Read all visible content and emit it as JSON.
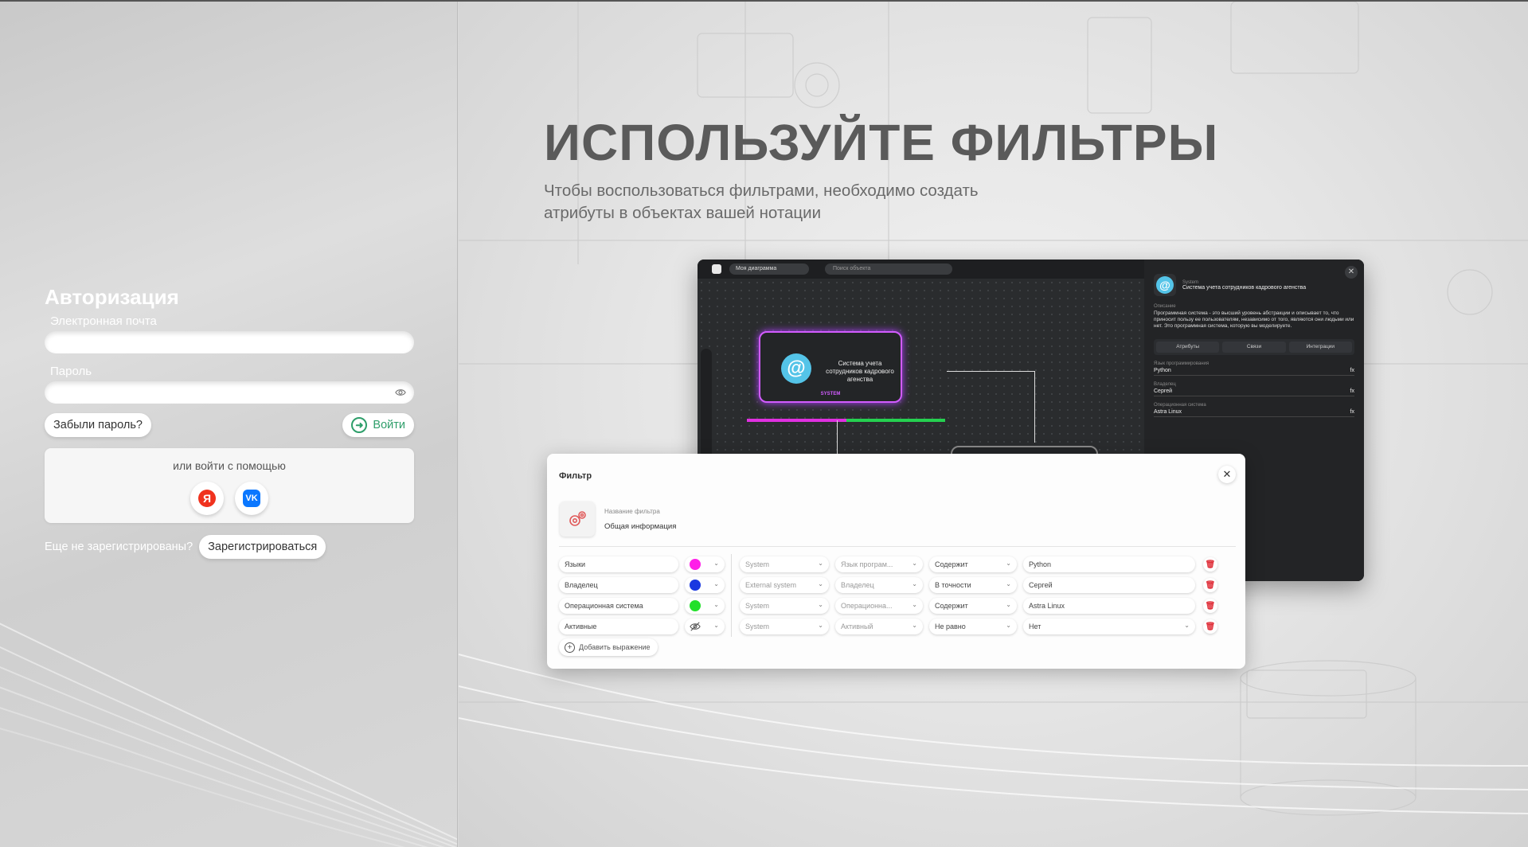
{
  "auth": {
    "title": "Авторизация",
    "email_label": "Электронная почта",
    "email_value": "",
    "password_label": "Пароль",
    "password_value": "",
    "forgot_label": "Забыли пароль?",
    "login_label": "Войти",
    "social_label": "или войти с помощью",
    "yandex_glyph": "Я",
    "vk_glyph": "VK",
    "not_registered": "Еще не зарегистрированы?",
    "register_label": "Зарегистрироваться"
  },
  "promo": {
    "title": "ИСПОЛЬЗУЙТЕ ФИЛЬТРЫ",
    "subtitle": "Чтобы воспользоваться фильтрами, необходимо создать атрибуты в объектах вашей нотации"
  },
  "app_mock": {
    "diagram_name": "Моя диаграмма",
    "search_placeholder": "Поиск объекта",
    "node_title": "Система учета сотрудников кадрового агенства",
    "node_type": "SYSTEM",
    "side": {
      "type": "System",
      "title": "Система учета сотрудников кадрового агенства",
      "desc_label": "Описание",
      "desc": "Программная система - это высший уровень абстракции и описывает то, что приносит пользу ее пользователям, независимо от того, являются они людьми или нет. Это программная система, которую вы моделируете.",
      "tabs": [
        "Атрибуты",
        "Связи",
        "Интеграции"
      ],
      "fields": [
        {
          "label": "Язык программирования",
          "value": "Python"
        },
        {
          "label": "Владелец",
          "value": "Сергей"
        },
        {
          "label": "Операционная система",
          "value": "Astra Linux"
        }
      ],
      "fx": "fx"
    }
  },
  "filter": {
    "title": "Фильтр",
    "name_label": "Название фильтра",
    "name_value": "Общая информация",
    "rows": [
      {
        "name": "Языки",
        "color": "#ff1ee8",
        "type": "System",
        "attr": "Язык програм...",
        "op": "Содержит",
        "value": "Python"
      },
      {
        "name": "Владелец",
        "color": "#1a38e0",
        "type": "External system",
        "attr": "Владелец",
        "op": "В точности",
        "value": "Сергей"
      },
      {
        "name": "Операционная система",
        "color": "#22e02a",
        "type": "System",
        "attr": "Операционна...",
        "op": "Содержит",
        "value": "Astra Linux"
      },
      {
        "name": "Активные",
        "color": "hidden",
        "type": "System",
        "attr": "Активный",
        "op": "Не равно",
        "value": "Нет"
      }
    ],
    "add_label": "Добавить выражение"
  },
  "icons": [
    "eye-icon",
    "arrow-right-circle-icon",
    "yandex-icon",
    "vk-icon",
    "close-icon",
    "filter-gear-icon",
    "chevron-down-icon",
    "trash-icon",
    "plus-circle-icon",
    "eye-off-icon"
  ]
}
